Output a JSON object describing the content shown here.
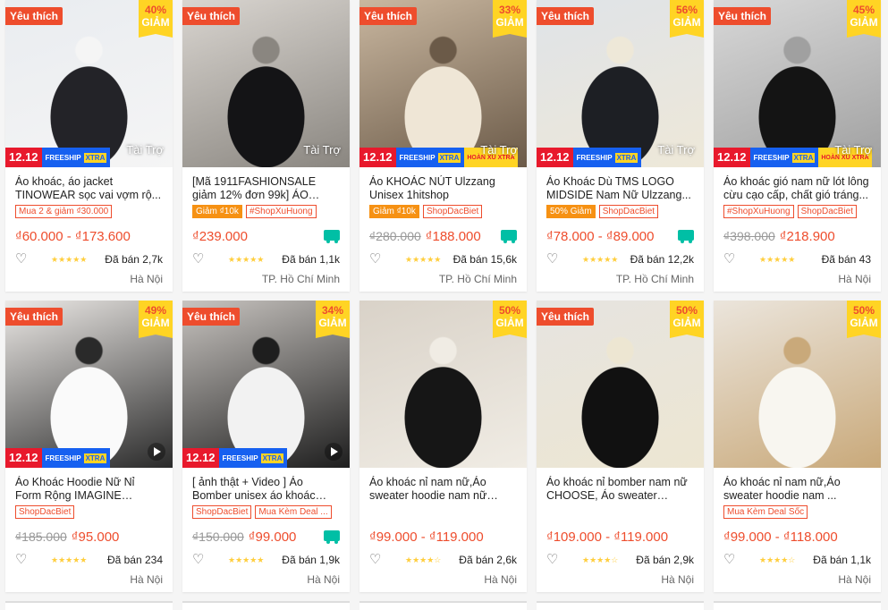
{
  "labels": {
    "favorite": "Yêu thích",
    "discount_word": "GIẢM",
    "sponsored": "Tài Trợ",
    "promo_1212": "12.12",
    "freeship": "FREESHIP",
    "xtra": "XTRA",
    "hoan_xu": "HOÀN XU XTRA"
  },
  "colors": {
    "brand": "#ee4d2d",
    "badge_yellow": "#ffd424",
    "promo_red": "#e8192c",
    "freeship_blue": "#1660f0",
    "star": "#ffce3d",
    "free_truck": "#00bfa5"
  },
  "products": [
    {
      "name": "Áo khoác, áo jacket TINOWEAR sọc vai vợm rộ...",
      "fav": true,
      "discount": "40%",
      "sponsored": true,
      "promo": "1212_free",
      "play": false,
      "tags": [
        {
          "text": "Mua 2 & giảm ₫30.000",
          "style": "outline"
        }
      ],
      "old_price": "",
      "price": "₫60.000 - ₫173.600",
      "free_ship": false,
      "rating": 5,
      "sold": "Đã bán 2,7k",
      "location": "Hà Nội",
      "photo": [
        "#e9ecf0",
        "#232328",
        "#f5f5f5"
      ]
    },
    {
      "name": "[Mã 1911FASHIONSALE giảm 12% đơn 99k] ÁO BOMBER...",
      "fav": true,
      "discount": "",
      "sponsored": true,
      "promo": "",
      "play": false,
      "tags": [
        {
          "text": "Giảm ₫10k",
          "style": "solid"
        },
        {
          "text": "#ShopXuHuong",
          "style": "outline"
        }
      ],
      "old_price": "",
      "price": "₫239.000",
      "free_ship": true,
      "rating": 5,
      "sold": "Đã bán 1,1k",
      "location": "TP. Hồ Chí Minh",
      "photo": [
        "#d9d5d0",
        "#141416",
        "#8a8680"
      ]
    },
    {
      "name": "Áo KHOÁC NÚT Ulzzang Unisex 1hitshop",
      "fav": true,
      "discount": "33%",
      "sponsored": true,
      "promo": "1212_free_hoan",
      "play": false,
      "tags": [
        {
          "text": "Giảm ₫10k",
          "style": "solid"
        },
        {
          "text": "ShopDacBiet",
          "style": "outline"
        }
      ],
      "old_price": "₫280.000",
      "price": "₫188.000",
      "free_ship": true,
      "rating": 5,
      "sold": "Đã bán 15,6k",
      "location": "TP. Hồ Chí Minh",
      "photo": [
        "#c9b7a0",
        "#efe6d6",
        "#6b5a48"
      ]
    },
    {
      "name": "Áo Khoác Dù TMS LOGO MIDSIDE Nam Nữ Ulzzang...",
      "fav": true,
      "discount": "56%",
      "sponsored": true,
      "promo": "1212_free",
      "play": false,
      "tags": [
        {
          "text": "50% Giảm",
          "style": "solid"
        },
        {
          "text": "ShopDacBiet",
          "style": "outline"
        }
      ],
      "old_price": "",
      "price": "₫78.000 - ₫89.000",
      "free_ship": true,
      "rating": 5,
      "sold": "Đã bán 12,2k",
      "location": "TP. Hồ Chí Minh",
      "photo": [
        "#dfe3e8",
        "#1d1f24",
        "#eee8d8"
      ]
    },
    {
      "name": "Áo khoác gió nam nữ lót lông cừu cạo cấp, chất gió tráng...",
      "fav": true,
      "discount": "45%",
      "sponsored": true,
      "promo": "1212_free_hoan",
      "play": false,
      "tags": [
        {
          "text": "#ShopXuHuong",
          "style": "outline"
        },
        {
          "text": "ShopDacBiet",
          "style": "outline"
        }
      ],
      "old_price": "₫398.000",
      "price": "₫218.900",
      "free_ship": false,
      "rating": 5,
      "sold": "Đã bán 43",
      "location": "Hà Nội",
      "photo": [
        "#d8d8d8",
        "#141414",
        "#a0a0a0"
      ]
    },
    {
      "name": "Áo Khoác Hoodie Nữ Nỉ Form Rộng IMAGINE Unisex...",
      "fav": true,
      "discount": "49%",
      "sponsored": false,
      "promo": "1212_free",
      "play": true,
      "tags": [
        {
          "text": "ShopDacBiet",
          "style": "outline"
        }
      ],
      "old_price": "₫185.000",
      "price": "₫95.000",
      "free_ship": false,
      "rating": 5,
      "sold": "Đã bán 234",
      "location": "Hà Nội",
      "photo": [
        "#ece9e6",
        "#fafafa",
        "#2a2a2a"
      ]
    },
    {
      "name": "[ ảnh thật + Video ] Áo Bomber unisex áo khoác nam nữ mặ...",
      "fav": true,
      "discount": "34%",
      "sponsored": false,
      "promo": "1212_free",
      "play": true,
      "tags": [
        {
          "text": "ShopDacBiet",
          "style": "outline"
        },
        {
          "text": "Mua Kèm Deal ...",
          "style": "outline"
        }
      ],
      "old_price": "₫150.000",
      "price": "₫99.000",
      "free_ship": true,
      "rating": 5,
      "sold": "Đã bán 1,9k",
      "location": "Hà Nội",
      "photo": [
        "#c8c4c0",
        "#f2f2f2",
        "#1e1e1e"
      ]
    },
    {
      "name": "Áo khoác nỉ nam nữ,Áo sweater hoodie nam nữ from...",
      "fav": false,
      "discount": "50%",
      "sponsored": false,
      "promo": "",
      "play": false,
      "tags": [],
      "old_price": "",
      "price": "₫99.000 - ₫119.000",
      "free_ship": false,
      "rating": 4.5,
      "sold": "Đã bán 2,6k",
      "location": "Hà Nội",
      "photo": [
        "#d9d2c8",
        "#161616",
        "#f0ece4"
      ]
    },
    {
      "name": "Áo khoác nỉ bomber nam nữ CHOOSE, Áo sweater hoodi...",
      "fav": true,
      "discount": "50%",
      "sponsored": false,
      "promo": "",
      "play": false,
      "tags": [],
      "old_price": "",
      "price": "₫109.000 - ₫119.000",
      "free_ship": false,
      "rating": 4.5,
      "sold": "Đã bán 2,9k",
      "location": "Hà Nội",
      "photo": [
        "#e6e4e0",
        "#111111",
        "#ede6d2"
      ]
    },
    {
      "name": "Áo khoác nỉ nam nữ,Áo sweater hoodie nam ...",
      "fav": false,
      "discount": "50%",
      "sponsored": false,
      "promo": "",
      "play": false,
      "tags": [
        {
          "text": "Mua Kèm Deal Sốc",
          "style": "outline"
        }
      ],
      "old_price": "",
      "price": "₫99.000 - ₫118.000",
      "free_ship": false,
      "rating": 4.5,
      "sold": "Đã bán 1,1k",
      "location": "Hà Nội",
      "photo": [
        "#ebe5dc",
        "#f8f6f0",
        "#c9a97a"
      ]
    }
  ]
}
